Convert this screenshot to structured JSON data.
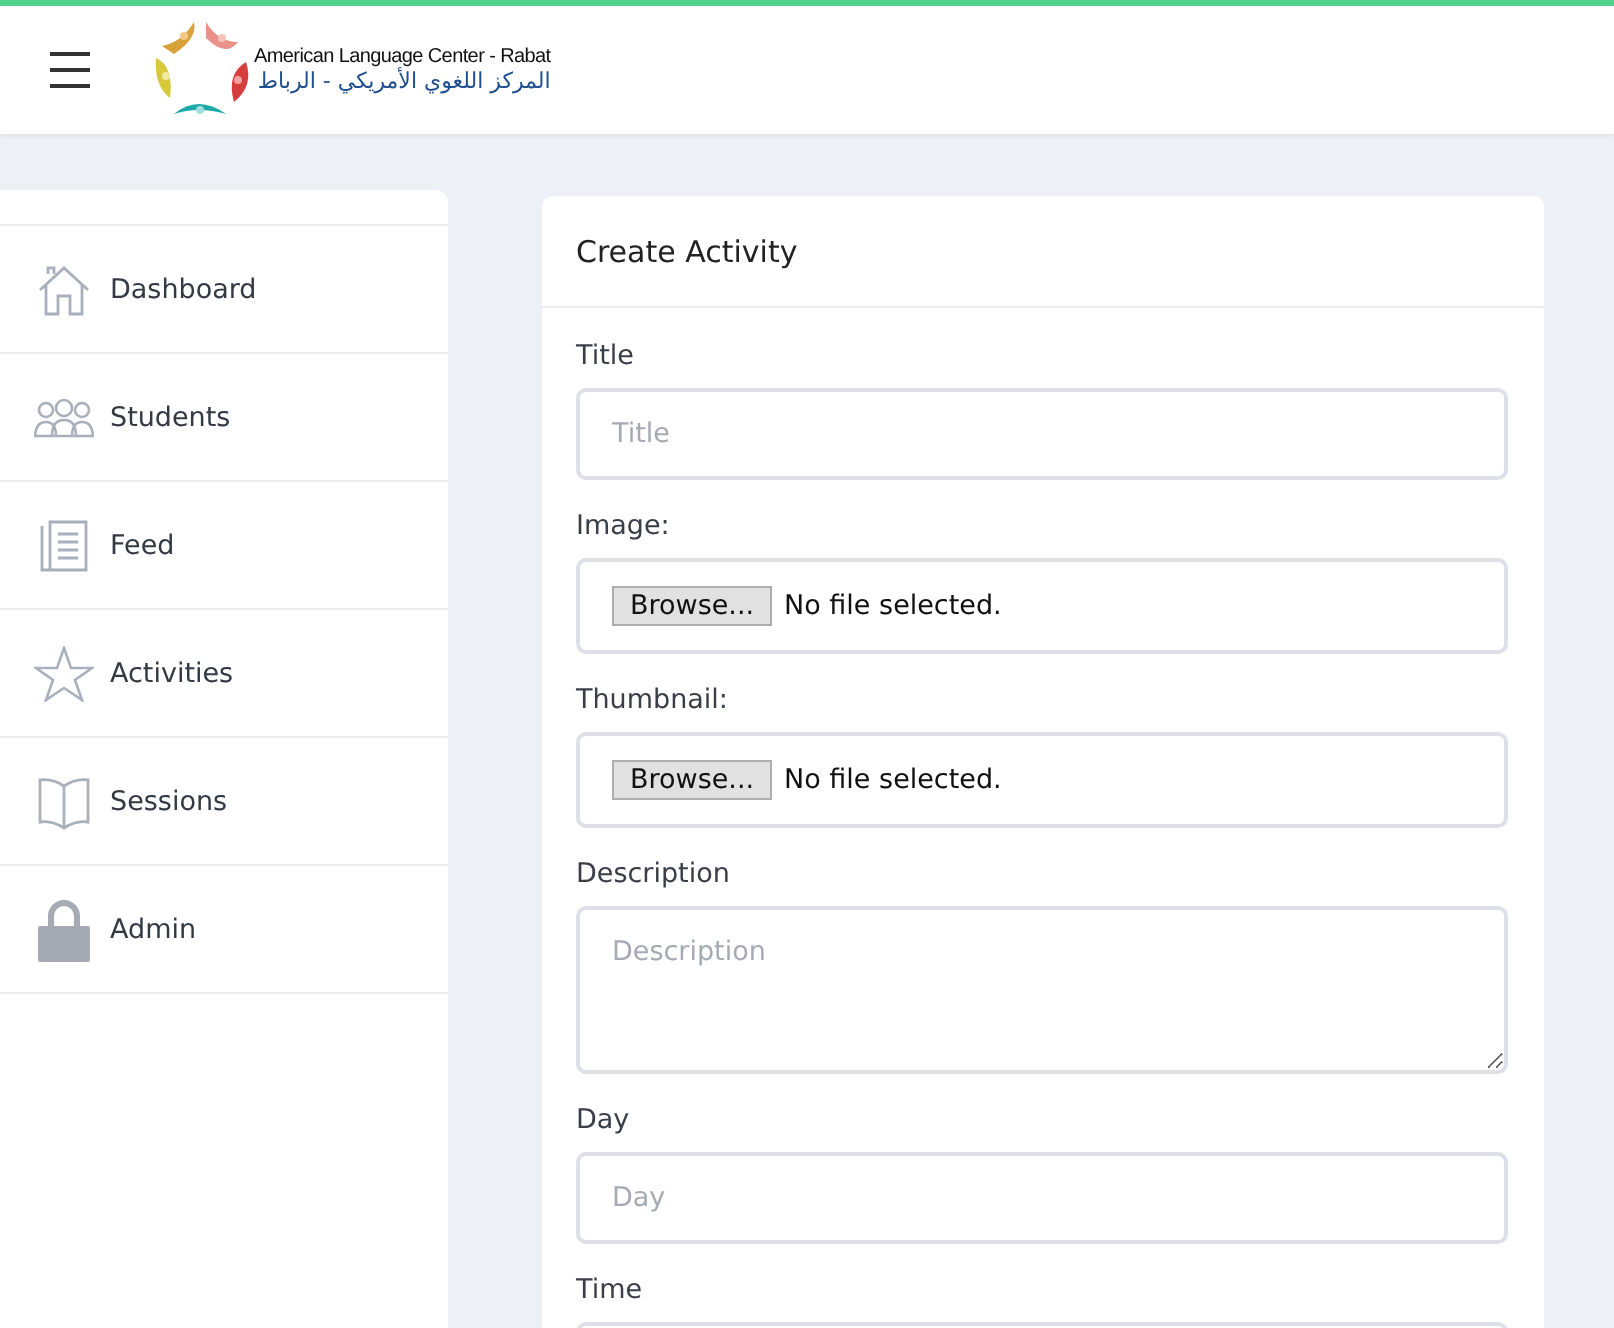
{
  "header": {
    "brand_en": "American Language Center - Rabat",
    "brand_ar": "المركز اللغوي الأمريكي - الرباط"
  },
  "sidebar": {
    "items": [
      {
        "label": "Dashboard",
        "kind": "home"
      },
      {
        "label": "Students",
        "kind": "people"
      },
      {
        "label": "Feed",
        "kind": "feed"
      },
      {
        "label": "Activities",
        "kind": "star"
      },
      {
        "label": "Sessions",
        "kind": "book"
      },
      {
        "label": "Admin",
        "kind": "lock"
      }
    ]
  },
  "form": {
    "title": "Create Activity",
    "fields": [
      {
        "kind": "text",
        "label": "Title",
        "placeholder": "Title"
      },
      {
        "kind": "file",
        "label": "Image:",
        "button": "Browse...",
        "status": "No file selected."
      },
      {
        "kind": "file",
        "label": "Thumbnail:",
        "button": "Browse...",
        "status": "No file selected."
      },
      {
        "kind": "textarea",
        "label": "Description",
        "placeholder": "Description"
      },
      {
        "kind": "text",
        "label": "Day",
        "placeholder": "Day"
      },
      {
        "kind": "text",
        "label": "Time"
      }
    ]
  }
}
